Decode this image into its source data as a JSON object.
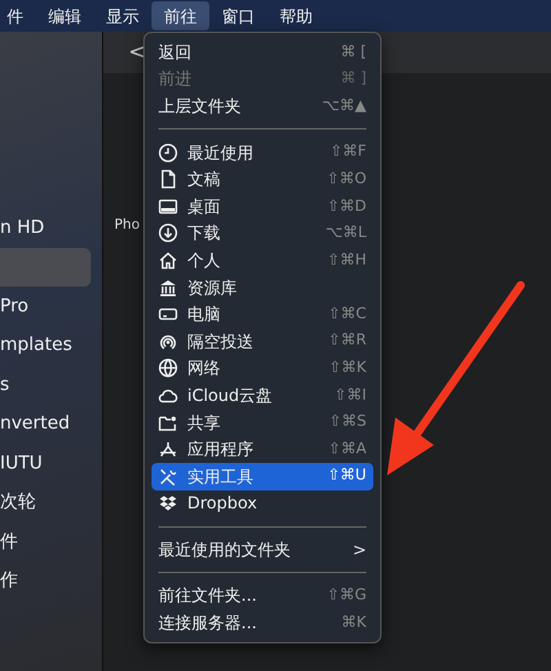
{
  "menu_bar": [
    {
      "label": "件",
      "selected": false
    },
    {
      "label": "编辑",
      "selected": false
    },
    {
      "label": "显示",
      "selected": false
    },
    {
      "label": "前往",
      "selected": true
    },
    {
      "label": "窗口",
      "selected": false
    },
    {
      "label": "帮助",
      "selected": false
    }
  ],
  "sidebar": {
    "items": [
      {
        "label": "n HD",
        "selected": false
      },
      {
        "selected": true
      },
      {
        "label": "Pro",
        "selected": false
      },
      {
        "label": "mplates",
        "selected": false
      },
      {
        "label": "s",
        "selected": false
      },
      {
        "label": "nverted",
        "selected": false
      },
      {
        "label": "IUTU",
        "selected": false
      },
      {
        "label": "次轮",
        "selected": false
      },
      {
        "label": "件",
        "selected": false
      },
      {
        "label": "作",
        "selected": false
      }
    ]
  },
  "toolbar": {
    "back": "<"
  },
  "content": {
    "file_label": "Pho"
  },
  "go_menu": {
    "items": [
      {
        "kind": "item",
        "label": "返回",
        "shortcut": "⌘ [",
        "disabled": false,
        "selected": false
      },
      {
        "kind": "item",
        "label": "前进",
        "shortcut": "⌘ ]",
        "disabled": true,
        "selected": false
      },
      {
        "kind": "item",
        "label": "上层文件夹",
        "shortcut": "⌥⌘▲",
        "disabled": false,
        "selected": false
      },
      {
        "kind": "separator"
      },
      {
        "kind": "icon-item",
        "label": "最近使用",
        "shortcut": "⇧⌘F",
        "disabled": false,
        "selected": false
      },
      {
        "kind": "icon-item",
        "label": "文稿",
        "shortcut": "⇧⌘O",
        "disabled": false,
        "selected": false
      },
      {
        "kind": "icon-item",
        "label": "桌面",
        "shortcut": "⇧⌘D",
        "disabled": false,
        "selected": false
      },
      {
        "kind": "icon-item",
        "label": "下载",
        "shortcut": "⌥⌘L",
        "disabled": false,
        "selected": false
      },
      {
        "kind": "icon-item",
        "label": "个人",
        "shortcut": "⇧⌘H",
        "disabled": false,
        "selected": false
      },
      {
        "kind": "icon-item",
        "label": "资源库",
        "disabled": false,
        "selected": false
      },
      {
        "kind": "icon-item",
        "label": "电脑",
        "shortcut": "⇧⌘C",
        "disabled": false,
        "selected": false
      },
      {
        "kind": "icon-item",
        "label": "隔空投送",
        "shortcut": "⇧⌘R",
        "disabled": false,
        "selected": false
      },
      {
        "kind": "icon-item",
        "label": "网络",
        "shortcut": "⇧⌘K",
        "disabled": false,
        "selected": false
      },
      {
        "kind": "icon-item",
        "label": "iCloud云盘",
        "shortcut": "⇧⌘I",
        "disabled": false,
        "selected": false
      },
      {
        "kind": "icon-item",
        "label": "共享",
        "shortcut": "⇧⌘S",
        "disabled": false,
        "selected": false
      },
      {
        "kind": "icon-item",
        "label": "应用程序",
        "shortcut": "⇧⌘A",
        "disabled": false,
        "selected": false
      },
      {
        "kind": "icon-item",
        "label": "实用工具",
        "shortcut": "⇧⌘U",
        "disabled": false,
        "selected": true
      },
      {
        "kind": "icon-item",
        "label": "Dropbox",
        "disabled": false,
        "selected": false
      },
      {
        "kind": "separator"
      },
      {
        "kind": "submenu",
        "label": "最近使用的文件夹",
        "arrow": ">",
        "disabled": false,
        "selected": false
      },
      {
        "kind": "separator"
      },
      {
        "kind": "item",
        "label": "前往文件夹...",
        "shortcut": "⇧⌘G",
        "disabled": false,
        "selected": false
      },
      {
        "kind": "item",
        "label": "连接服务器...",
        "shortcut": "⌘K",
        "disabled": false,
        "selected": false
      }
    ]
  }
}
